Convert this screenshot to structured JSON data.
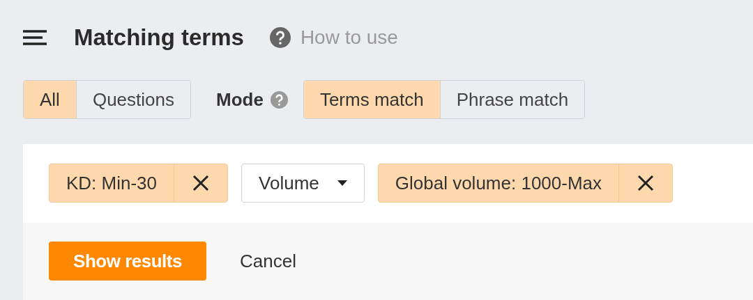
{
  "header": {
    "title": "Matching terms",
    "help_link": "How to use"
  },
  "type_tabs": [
    {
      "label": "All",
      "selected": true
    },
    {
      "label": "Questions",
      "selected": false
    }
  ],
  "mode": {
    "label": "Mode",
    "options": [
      {
        "label": "Terms match",
        "selected": true
      },
      {
        "label": "Phrase match",
        "selected": false
      }
    ]
  },
  "filters": [
    {
      "kind": "chip",
      "label": "KD: Min-30"
    },
    {
      "kind": "dropdown",
      "label": "Volume"
    },
    {
      "kind": "chip",
      "label": "Global volume: 1000-Max"
    }
  ],
  "actions": {
    "primary": "Show results",
    "secondary": "Cancel"
  }
}
